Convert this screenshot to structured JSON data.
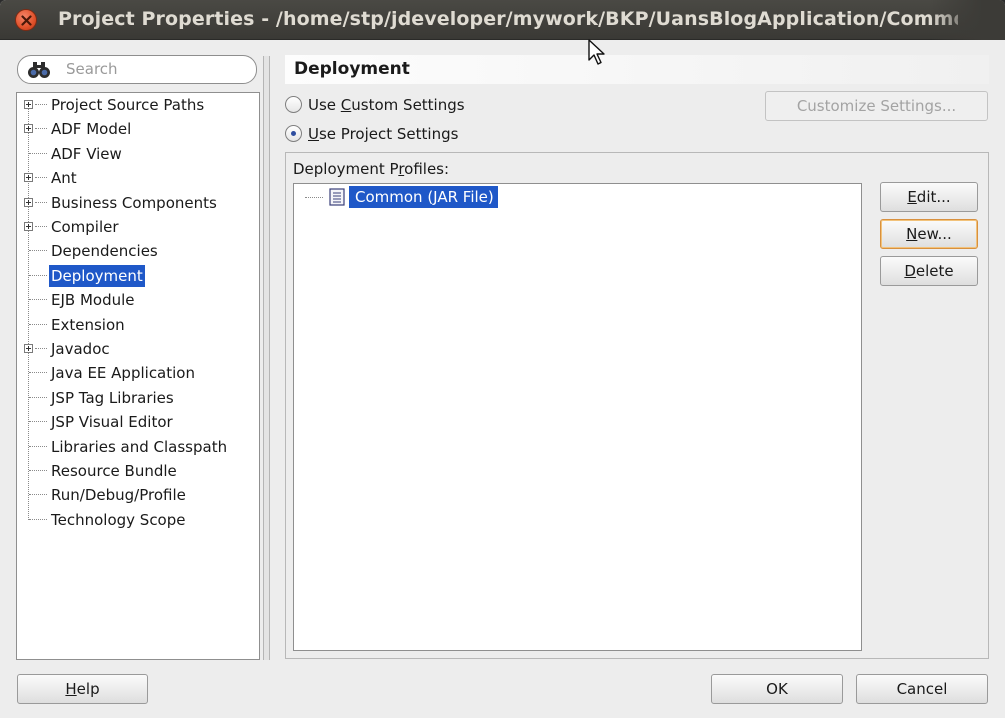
{
  "window": {
    "title": "Project Properties - /home/stp/jdeveloper/mywork/BKP/UansBlogApplication/Common/Common.jpr"
  },
  "search": {
    "placeholder": "Search"
  },
  "tree": {
    "items": [
      {
        "label": "Project Source Paths",
        "expandable": true
      },
      {
        "label": "ADF Model",
        "expandable": true
      },
      {
        "label": "ADF View",
        "expandable": false
      },
      {
        "label": "Ant",
        "expandable": true
      },
      {
        "label": "Business Components",
        "expandable": true
      },
      {
        "label": "Compiler",
        "expandable": true
      },
      {
        "label": "Dependencies",
        "expandable": false
      },
      {
        "label": "Deployment",
        "expandable": false,
        "selected": true
      },
      {
        "label": "EJB Module",
        "expandable": false
      },
      {
        "label": "Extension",
        "expandable": false
      },
      {
        "label": "Javadoc",
        "expandable": true
      },
      {
        "label": "Java EE Application",
        "expandable": false
      },
      {
        "label": "JSP Tag Libraries",
        "expandable": false
      },
      {
        "label": "JSP Visual Editor",
        "expandable": false
      },
      {
        "label": "Libraries and Classpath",
        "expandable": false
      },
      {
        "label": "Resource Bundle",
        "expandable": false
      },
      {
        "label": "Run/Debug/Profile",
        "expandable": false
      },
      {
        "label": "Technology Scope",
        "expandable": false
      }
    ]
  },
  "panel": {
    "header": "Deployment",
    "radio_custom_pre": "Use ",
    "radio_custom_key": "C",
    "radio_custom_post": "ustom Settings",
    "radio_project_key": "U",
    "radio_project_post": "se Project Settings",
    "customize_button": "Customize Settings...",
    "profiles_label_pre": "Deployment P",
    "profiles_label_key": "r",
    "profiles_label_post": "ofiles:",
    "profiles": [
      {
        "label": "Common (JAR File)",
        "selected": true
      }
    ],
    "edit_key": "E",
    "edit_post": "dit...",
    "new_key": "N",
    "new_post": "ew...",
    "delete_key": "D",
    "delete_post": "elete"
  },
  "footer": {
    "help_key": "H",
    "help_post": "elp",
    "ok": "OK",
    "cancel": "Cancel"
  },
  "colors": {
    "selection": "#1f58c8",
    "titlebar": "#3c3b37",
    "close": "#e0512a"
  }
}
